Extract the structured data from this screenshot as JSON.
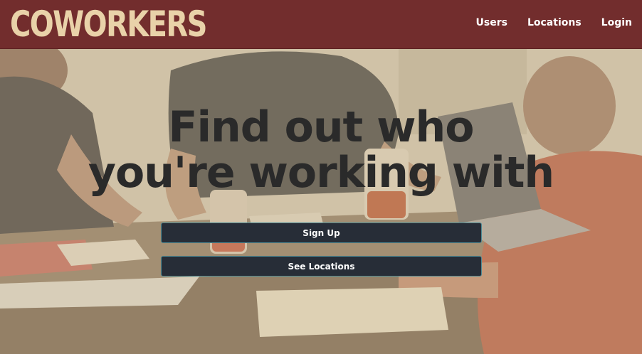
{
  "navbar": {
    "brand": "COWORKERS",
    "links": [
      {
        "label": "Users"
      },
      {
        "label": "Locations"
      },
      {
        "label": "Login"
      }
    ]
  },
  "hero": {
    "headline_line1": "Find out who",
    "headline_line2": "you're working with",
    "signup_label": "Sign Up",
    "locations_label": "See Locations"
  },
  "colors": {
    "navbar_bg": "#722d2d",
    "brand_text": "#e9d2a9",
    "button_bg": "#272d37",
    "button_border": "#4e8b95",
    "headline_text": "#2a2a2a"
  }
}
